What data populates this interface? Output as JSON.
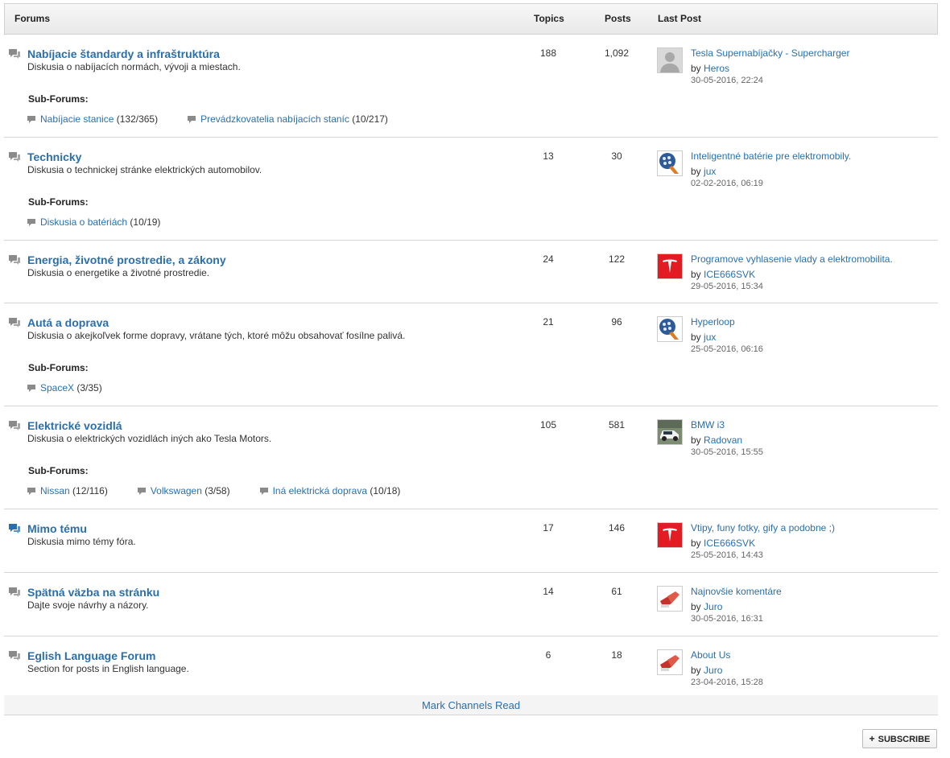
{
  "header": {
    "forums": "Forums",
    "topics": "Topics",
    "posts": "Posts",
    "last_post": "Last Post"
  },
  "forums": [
    {
      "title": "Nabíjacie štandardy a infraštruktúra",
      "desc": "Diskusia o nabíjacích normách, vývoji a miestach.",
      "topics": "188",
      "posts": "1,092",
      "sub_label": "Sub-Forums:",
      "subs": [
        {
          "name": "Nabíjacie stanice",
          "count": "(132/365)"
        },
        {
          "name": "Prevádzkovatelia nabíjacích staníc",
          "count": "(10/217)"
        }
      ],
      "last": {
        "title": "Tesla Supernabíjačky - Supercharger",
        "by": "by",
        "user": "Heros",
        "date": "30-05-2016, 22:24",
        "avatar": "default-avatar"
      }
    },
    {
      "title": "Technicky",
      "desc": "Diskusia o technickej stránke elektrických automobilov.",
      "topics": "13",
      "posts": "30",
      "sub_label": "Sub-Forums:",
      "subs": [
        {
          "name": "Diskusia o batériách",
          "count": "(10/19)"
        }
      ],
      "last": {
        "title": "Inteligentné batérie pre elektromobily.",
        "by": "by",
        "user": "jux",
        "date": "02-02-2016, 06:19",
        "avatar": "plug-avatar"
      }
    },
    {
      "title": "Energia, životné prostredie, a zákony",
      "desc": "Diskusia o energetike a životné prostredie.",
      "topics": "24",
      "posts": "122",
      "last": {
        "title": "Programove vyhlasenie vlady a elektromobilita.",
        "by": "by",
        "user": "ICE666SVK",
        "date": "29-05-2016, 15:34",
        "avatar": "tesla-avatar"
      }
    },
    {
      "title": "Autá a doprava",
      "desc": "Diskusia o akejkoľvek forme dopravy, vrátane tých, ktoré môžu obsahovať fosílne palivá.",
      "topics": "21",
      "posts": "96",
      "sub_label": "Sub-Forums:",
      "subs": [
        {
          "name": "SpaceX",
          "count": "(3/35)"
        }
      ],
      "last": {
        "title": "Hyperloop",
        "by": "by",
        "user": "jux",
        "date": "25-05-2016, 06:16",
        "avatar": "plug-avatar"
      }
    },
    {
      "title": "Elektrické vozidlá",
      "desc": "Diskusia o elektrických vozidlách iných ako Tesla Motors.",
      "topics": "105",
      "posts": "581",
      "sub_label": "Sub-Forums:",
      "subs": [
        {
          "name": "Nissan",
          "count": "(12/116)"
        },
        {
          "name": "Volkswagen",
          "count": "(3/58)"
        },
        {
          "name": "Iná elektrická doprava",
          "count": "(10/18)"
        }
      ],
      "last": {
        "title": "BMW i3",
        "by": "by",
        "user": "Radovan",
        "date": "30-05-2016, 15:55",
        "avatar": "car-avatar"
      }
    },
    {
      "title": "Mimo tému",
      "desc": "Diskusia mimo témy fóra.",
      "topics": "17",
      "posts": "146",
      "unread": true,
      "last": {
        "title": "Vtipy, funy fotky, gify a podobne ;)",
        "by": "by",
        "user": "ICE666SVK",
        "date": "25-05-2016, 14:43",
        "avatar": "tesla-avatar"
      }
    },
    {
      "title": "Spätná väzba na stránku",
      "desc": "Dajte svoje návrhy a názory.",
      "topics": "14",
      "posts": "61",
      "last": {
        "title": "Najnovšie komentáre",
        "by": "by",
        "user": "Juro",
        "date": "30-05-2016, 16:31",
        "avatar": "socket-avatar"
      }
    },
    {
      "title": "Eglish Language Forum",
      "desc": "Section for posts in English language.",
      "topics": "6",
      "posts": "18",
      "last": {
        "title": "About Us",
        "by": "by",
        "user": "Juro",
        "date": "23-04-2016, 15:28",
        "avatar": "socket-avatar"
      }
    }
  ],
  "footer": {
    "mark_read": "Mark Channels Read",
    "subscribe": "SUBSCRIBE",
    "subscribe_icon": "+"
  },
  "colors": {
    "link": "#2a6fad",
    "icon_read": "#8a8a8a",
    "icon_unread": "#2a6fad"
  }
}
